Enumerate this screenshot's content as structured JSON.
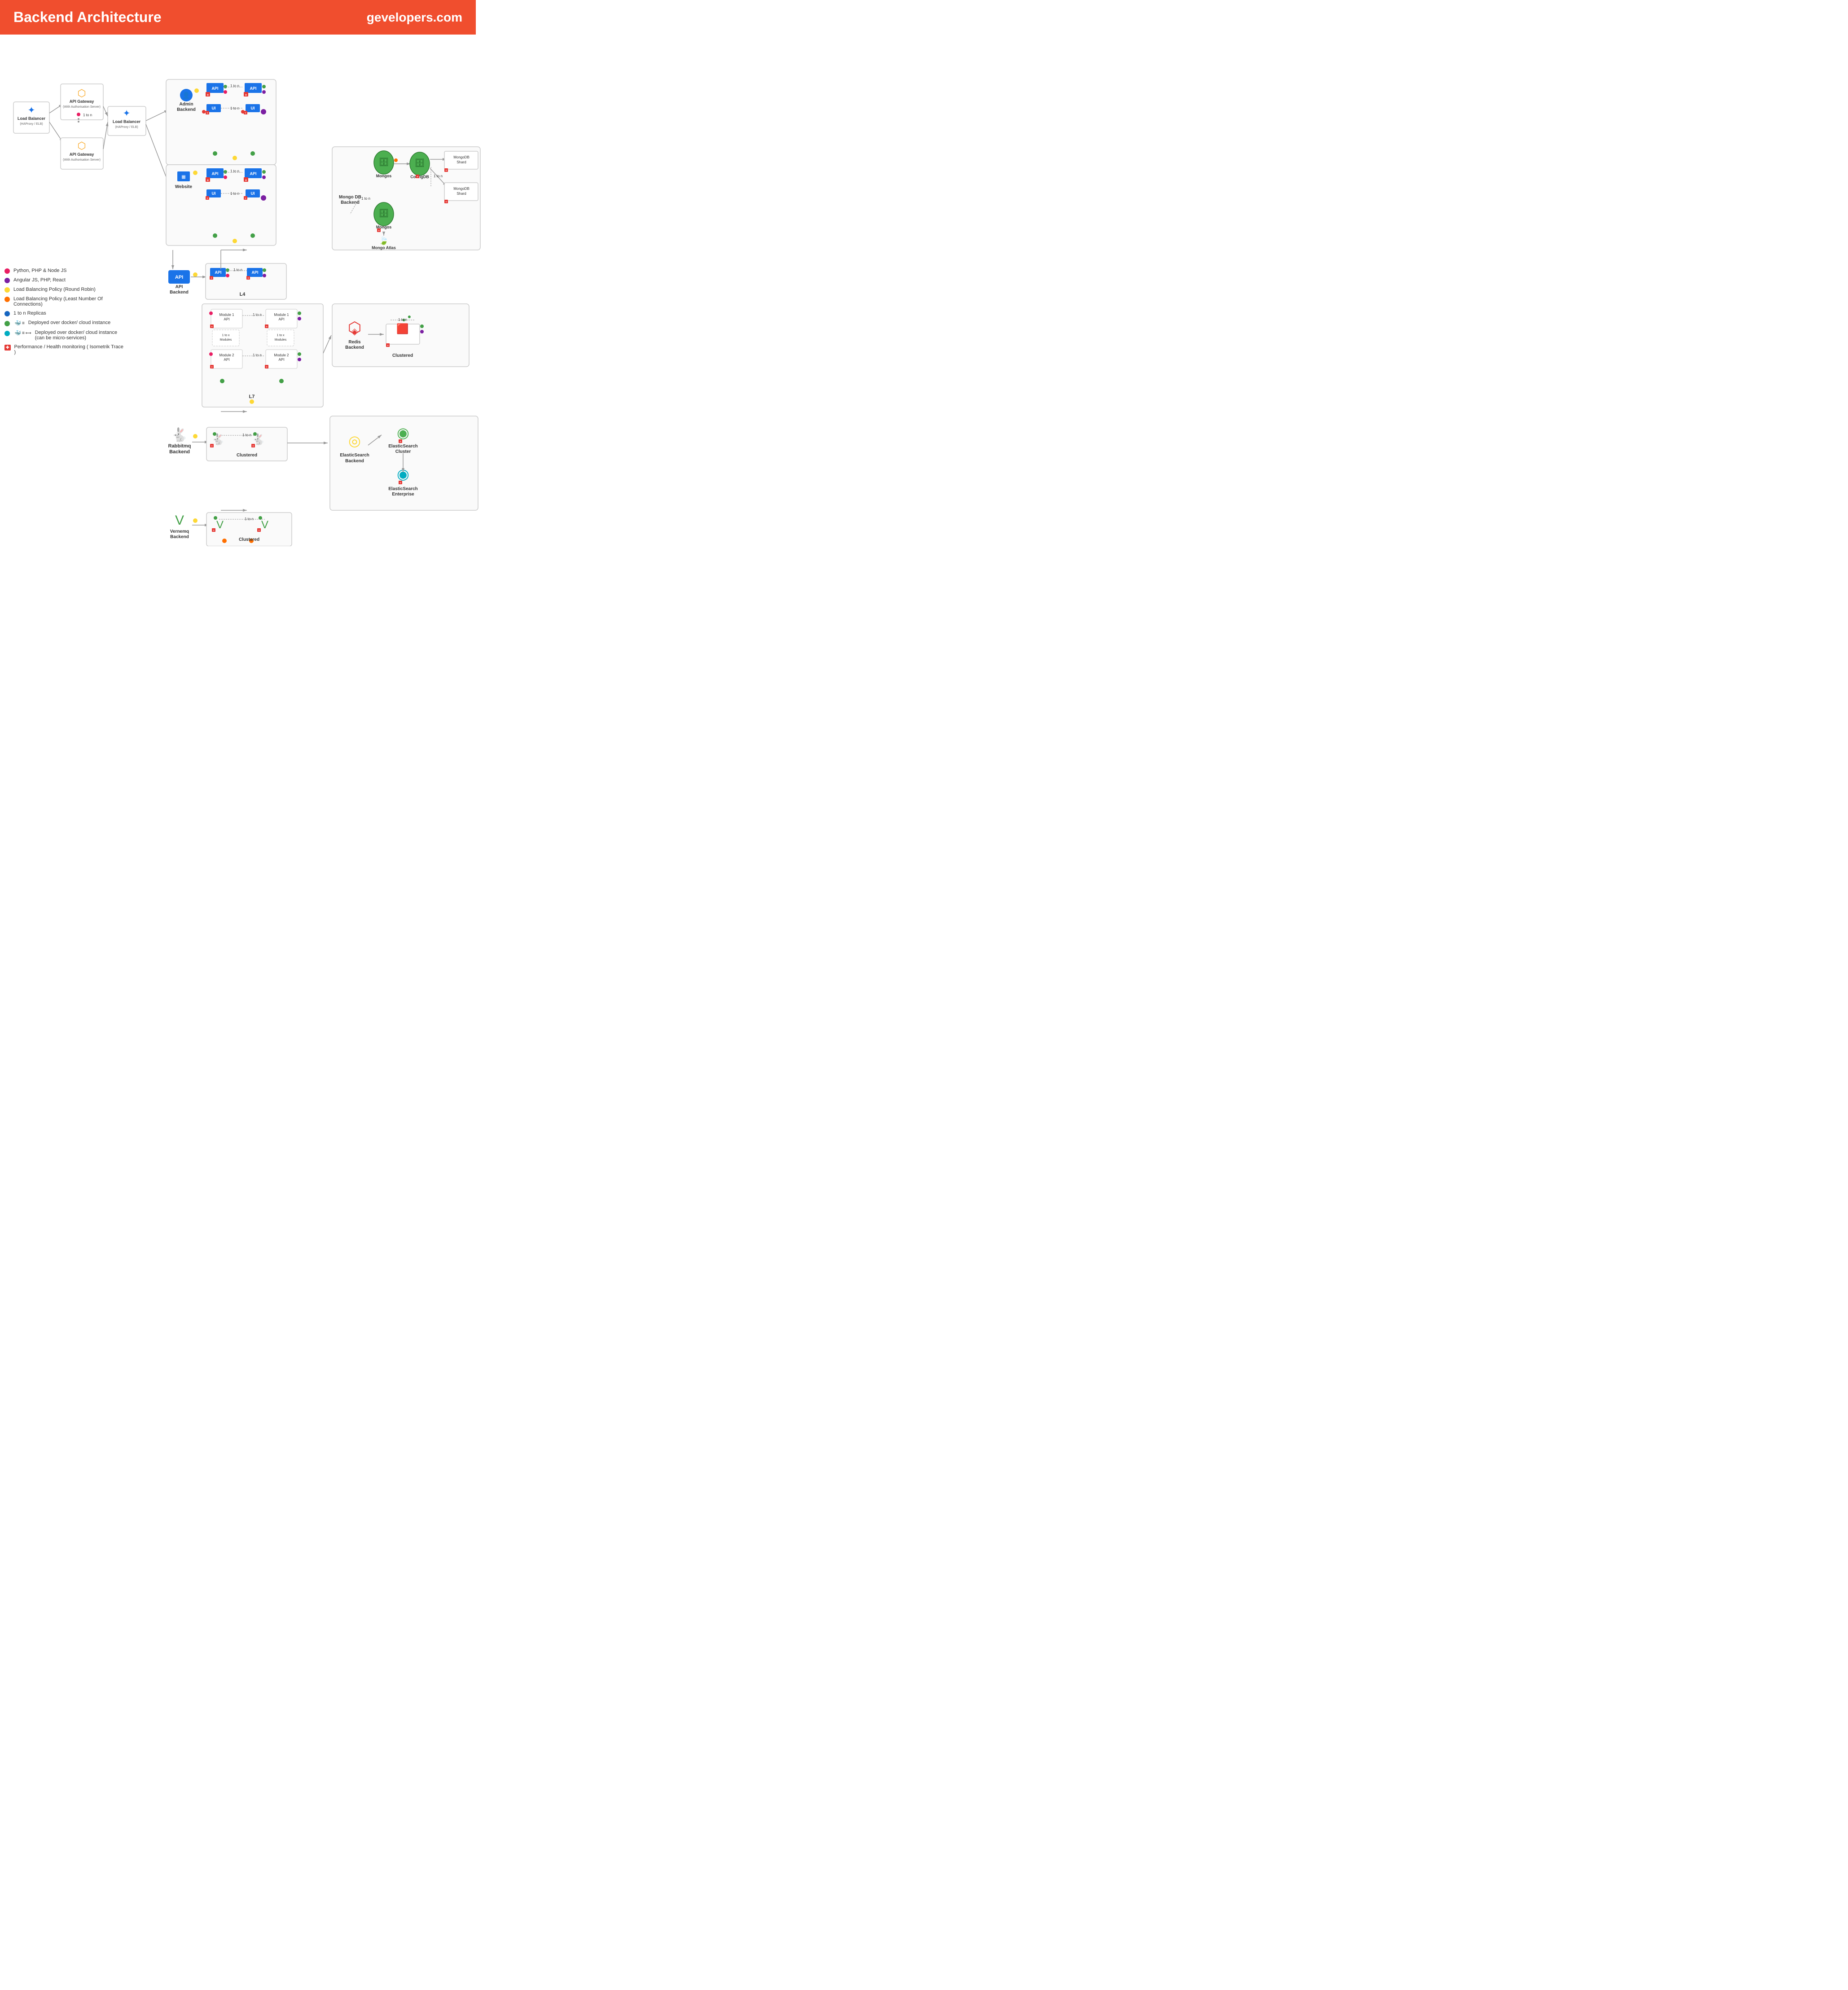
{
  "header": {
    "title": "Backend Architecture",
    "site": "gevelopers.com"
  },
  "legend": {
    "items": [
      {
        "color": "#e91e63",
        "text": "Python, PHP & Node JS"
      },
      {
        "color": "#7b1fa2",
        "text": "Angular JS, PHP, React"
      },
      {
        "color": "#fdd835",
        "text": "Load Balancing Policy (Round Robin)"
      },
      {
        "color": "#ff6f00",
        "text": "Load Balancing Policy (Least Number Of Connections)"
      },
      {
        "color": "#1565c0",
        "text": "1 to n Replicas"
      },
      {
        "color": "#43a047",
        "text": "Deployed over docker/ cloud instance"
      },
      {
        "color": "#00acc1",
        "text": "Deployed over docker/ cloud instance (can be micro-services)"
      },
      {
        "color": "#e53935",
        "text": "Performance / Health monitoring ( Isometrik Trace )"
      }
    ]
  }
}
